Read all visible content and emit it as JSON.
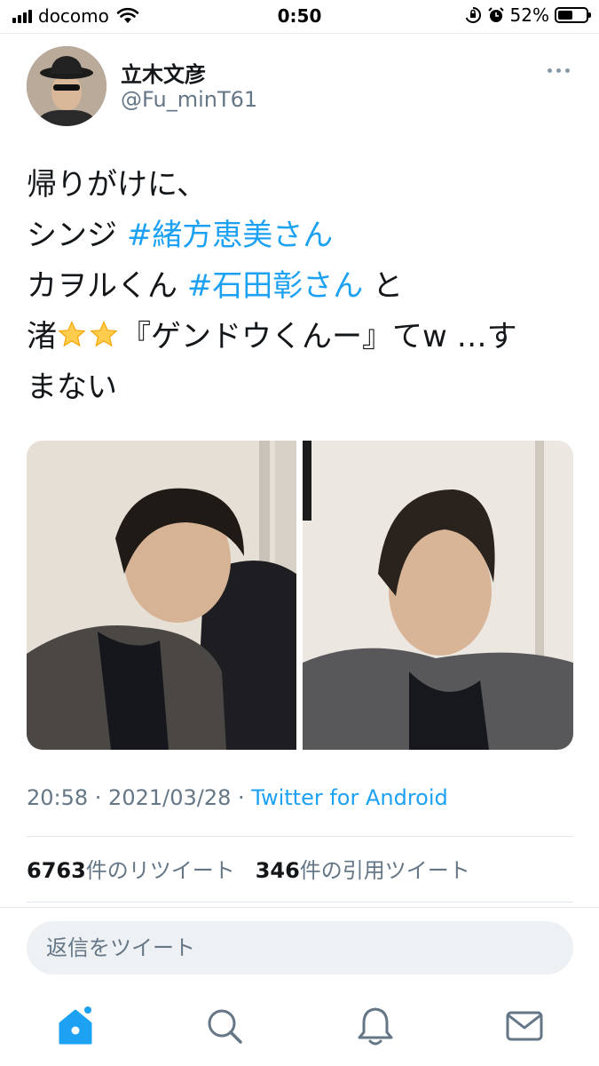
{
  "status_bar": {
    "carrier": "docomo",
    "time": "0:50",
    "battery": "52%",
    "battery_level": 0.52
  },
  "tweet": {
    "author_name": "立木文彦",
    "author_handle": "@Fu_minT61",
    "lines": {
      "l1": "帰りがけに、",
      "l2a": "シンジ ",
      "l2_hashtag": "#緒方恵美さん",
      "l3a": "カヲルくん ",
      "l3_hashtag": "#石田彰さん",
      "l3b": " と",
      "l4a": "渚",
      "l4b": "『ゲンドウくんー』てw …す",
      "l5": "まない"
    },
    "emoji": [
      "star-emoji",
      "star-emoji"
    ],
    "timestamp": "20:58 · 2021/03/28 · ",
    "source": "Twitter for Android",
    "retweet_count": "6763",
    "retweet_label": "件のリツイート",
    "quote_count": "346",
    "quote_label": "件の引用ツイート"
  },
  "reply": {
    "placeholder": "返信をツイート"
  },
  "tab_bar": {
    "items": [
      "home-icon",
      "search-icon",
      "notifications-icon",
      "messages-icon"
    ],
    "active_color": "#1da1f2",
    "inactive_color": "#657786"
  },
  "colors": {
    "accent": "#1da1f2",
    "secondary_text": "#657786"
  }
}
